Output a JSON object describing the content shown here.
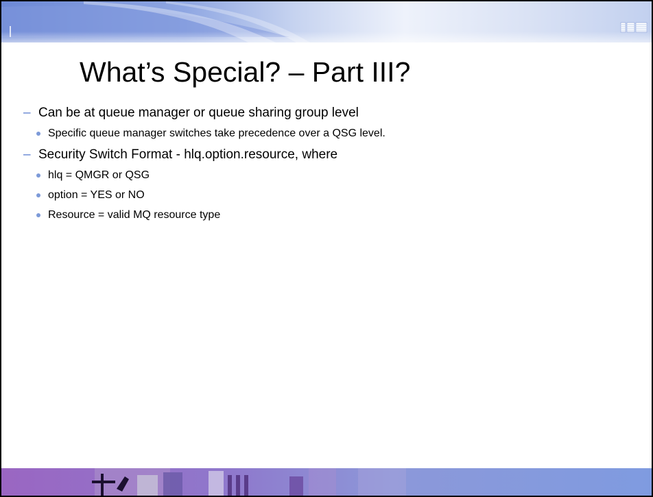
{
  "slide": {
    "title": "What’s Special? – Part III?",
    "logo_icon": "ibm-logo-icon",
    "bullets": [
      {
        "level": 1,
        "marker": "–",
        "text": "Can be at queue manager or queue sharing group level"
      },
      {
        "level": 2,
        "marker": "•",
        "text": "Specific queue manager switches take precedence over a QSG level."
      },
      {
        "level": 1,
        "marker": "–",
        "text": "Security Switch Format - hlq.option.resource, where"
      },
      {
        "level": 2,
        "marker": "•",
        "text": "hlq = QMGR or QSG"
      },
      {
        "level": 2,
        "marker": "•",
        "text": "option = YES or NO"
      },
      {
        "level": 2,
        "marker": "•",
        "text": "Resource = valid MQ resource type"
      }
    ]
  },
  "colors": {
    "banner_blue": "#6d89d6",
    "banner_light": "#dfe6f6",
    "dash_marker": "#5b7fd0",
    "dot_marker": "#7d9ad8",
    "footer_purple": "#9a66c2"
  }
}
